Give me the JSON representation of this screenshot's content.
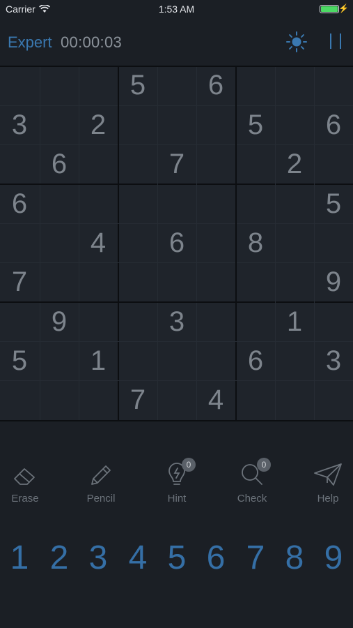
{
  "status_bar": {
    "carrier": "Carrier",
    "time": "1:53 AM"
  },
  "header": {
    "level": "Expert",
    "timer": "00:00:03"
  },
  "icons": {
    "theme": "sun-icon",
    "pause": "pause-icon",
    "wifi": "wifi-icon",
    "battery": "battery-icon"
  },
  "grid": [
    [
      "",
      "",
      "",
      "5",
      "",
      "6",
      "",
      "",
      ""
    ],
    [
      "3",
      "",
      "2",
      "",
      "",
      "",
      "5",
      "",
      "6"
    ],
    [
      "",
      "6",
      "",
      "",
      "7",
      "",
      "",
      "2",
      ""
    ],
    [
      "6",
      "",
      "",
      "",
      "",
      "",
      "",
      "",
      "5"
    ],
    [
      "",
      "",
      "4",
      "",
      "6",
      "",
      "8",
      "",
      ""
    ],
    [
      "7",
      "",
      "",
      "",
      "",
      "",
      "",
      "",
      "9"
    ],
    [
      "",
      "9",
      "",
      "",
      "3",
      "",
      "",
      "1",
      ""
    ],
    [
      "5",
      "",
      "1",
      "",
      "",
      "",
      "6",
      "",
      "3"
    ],
    [
      "",
      "",
      "",
      "7",
      "",
      "4",
      "",
      "",
      ""
    ]
  ],
  "tools": [
    {
      "label": "Erase",
      "icon": "eraser-icon"
    },
    {
      "label": "Pencil",
      "icon": "pencil-icon"
    },
    {
      "label": "Hint",
      "icon": "lightbulb-icon",
      "badge": "0"
    },
    {
      "label": "Check",
      "icon": "magnifier-icon",
      "badge": "0"
    },
    {
      "label": "Help",
      "icon": "paper-plane-icon"
    }
  ],
  "numpad": [
    "1",
    "2",
    "3",
    "4",
    "5",
    "6",
    "7",
    "8",
    "9"
  ],
  "colors": {
    "background": "#1b1f25",
    "accent": "#3a78b0",
    "given_digit": "#7d848c",
    "battery": "#4cd964"
  }
}
